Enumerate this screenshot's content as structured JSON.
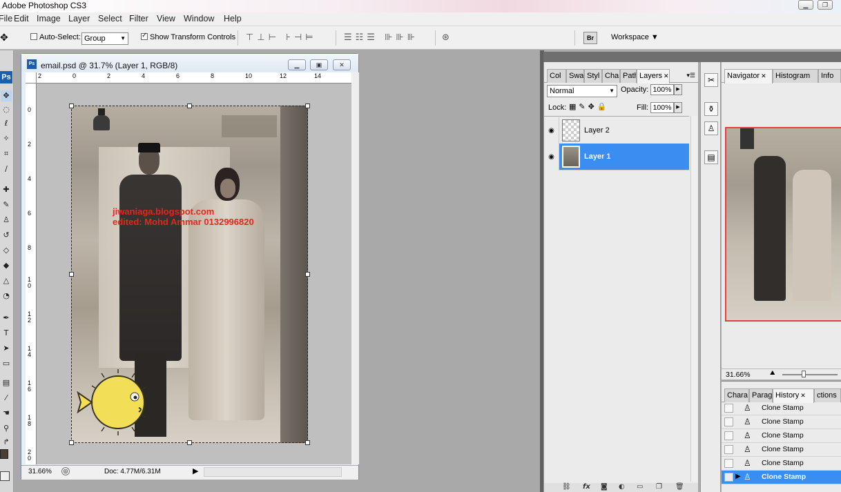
{
  "app": {
    "title": "Adobe Photoshop CS3"
  },
  "menu": [
    "File",
    "Edit",
    "Image",
    "Layer",
    "Select",
    "Filter",
    "View",
    "Window",
    "Help"
  ],
  "options": {
    "auto_select_label": "Auto-Select:",
    "auto_select_value": "Group",
    "show_transform_label": "Show Transform Controls",
    "workspace_label": "Workspace ▼",
    "bridge_label": "Br"
  },
  "tools": {
    "logo": "Ps"
  },
  "document": {
    "title": "email.psd @ 31.7% (Layer 1, RGB/8)",
    "ruler_h": [
      "2",
      "0",
      "2",
      "4",
      "6",
      "8",
      "10",
      "12",
      "14"
    ],
    "ruler_v": [
      "0",
      "2",
      "4",
      "6",
      "8",
      "1\n0",
      "1\n2",
      "1\n4",
      "1\n6",
      "1\n8",
      "2\n0"
    ],
    "zoom": "31.66%",
    "doc_size": "Doc: 4.77M/6.31M",
    "watermark_line1": "jiwaniaga.blogspot.com",
    "watermark_line2": "edited: Mohd Ammar 0132996820"
  },
  "layers_panel": {
    "tabs": [
      "Col",
      "Swa",
      "Styl",
      "Cha",
      "Path",
      "Layers"
    ],
    "active_tab": "Layers",
    "blend_mode": "Normal",
    "opacity_label": "Opacity:",
    "opacity_value": "100%",
    "lock_label": "Lock:",
    "fill_label": "Fill:",
    "fill_value": "100%",
    "layers": [
      {
        "name": "Layer 2",
        "selected": false
      },
      {
        "name": "Layer 1",
        "selected": true
      }
    ],
    "footer_icons": [
      "link-icon",
      "fx-icon",
      "mask-icon",
      "adjustment-icon",
      "folder-icon",
      "new-layer-icon",
      "trash-icon"
    ]
  },
  "navigator_panel": {
    "tabs": [
      "Navigator",
      "Histogram",
      "Info"
    ],
    "zoom": "31.66%"
  },
  "history_panel": {
    "tabs": [
      "Chara",
      "Parag",
      "History",
      "ctions"
    ],
    "items": [
      {
        "label": "Clone Stamp",
        "selected": false
      },
      {
        "label": "Clone Stamp",
        "selected": false
      },
      {
        "label": "Clone Stamp",
        "selected": false
      },
      {
        "label": "Clone Stamp",
        "selected": false
      },
      {
        "label": "Clone Stamp",
        "selected": false
      },
      {
        "label": "Clone Stamp",
        "selected": true
      }
    ]
  },
  "colors": {
    "selection_blue": "#3a8ef2",
    "nav_frame": "#e04040",
    "watermark": "#e0281e"
  }
}
